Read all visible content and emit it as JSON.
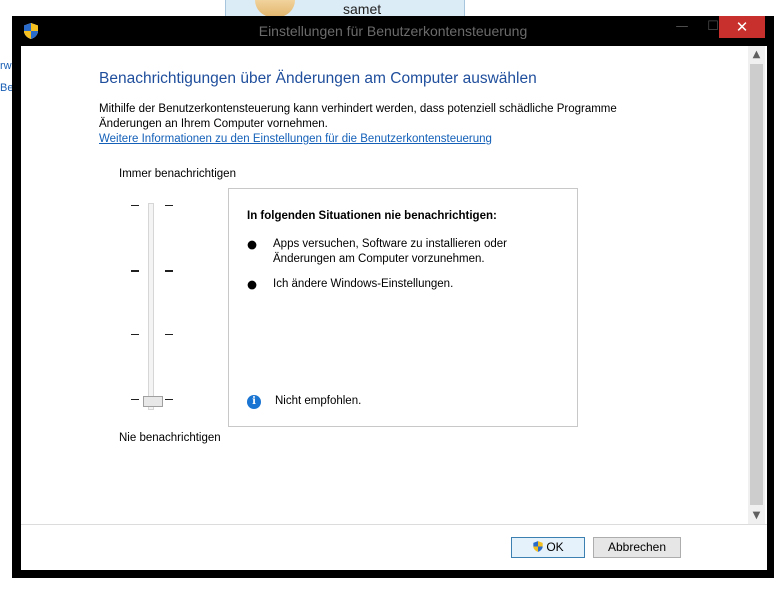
{
  "background": {
    "username": "samet",
    "side_text_1": "rw",
    "side_text_2": "Be"
  },
  "window": {
    "title": "Einstellungen für Benutzerkontensteuerung",
    "min_glyph": "—",
    "max_glyph": "☐",
    "close_glyph": "✕"
  },
  "main": {
    "heading": "Benachrichtigungen über Änderungen am Computer auswählen",
    "description_line1": "Mithilfe der Benutzerkontensteuerung kann verhindert werden, dass potenziell schädliche Programme",
    "description_line2": "Änderungen an Ihrem Computer vornehmen.",
    "more_info_link": "Weitere Informationen zu den Einstellungen für die Benutzerkontensteuerung"
  },
  "slider": {
    "top_label": "Immer benachrichtigen",
    "bottom_label": "Nie benachrichtigen",
    "levels": 4,
    "selected_level": 1
  },
  "info": {
    "title": "In folgenden Situationen nie benachrichtigen:",
    "bullets": [
      "Apps versuchen, Software zu installieren oder Änderungen am Computer vorzunehmen.",
      "Ich ändere Windows-Einstellungen."
    ],
    "bullet_glyph": "●",
    "note_icon_glyph": "i",
    "note": "Nicht empfohlen."
  },
  "scrollbar": {
    "up_glyph": "▲",
    "down_glyph": "▼"
  },
  "footer": {
    "ok_label": "OK",
    "cancel_label": "Abbrechen"
  },
  "colors": {
    "heading": "#1f4e9c",
    "link": "#1460b8",
    "close_button": "#c7302c",
    "info_icon": "#1a75d2"
  }
}
